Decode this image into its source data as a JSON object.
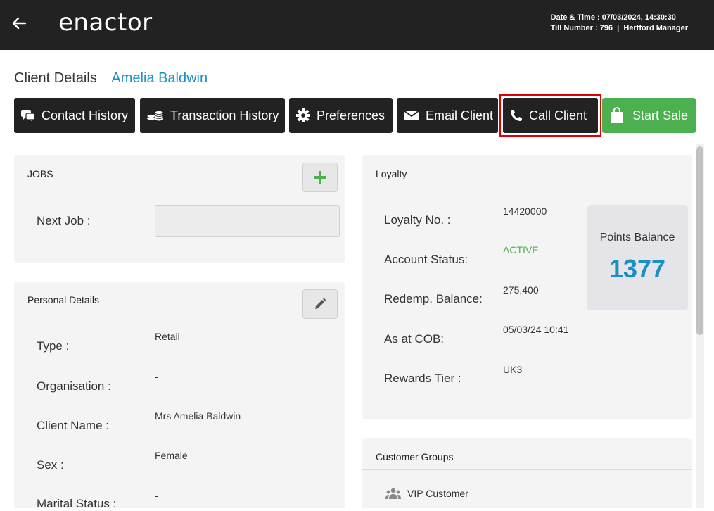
{
  "header": {
    "brand": "enactor",
    "datetime_label": "Date & Time : 07/03/2024, 14:30:30",
    "till_label": "Till Number : 796  |  Hertford Manager"
  },
  "page": {
    "title": "Client Details",
    "client_name": "Amelia Baldwin"
  },
  "actions": [
    {
      "label": "Contact History",
      "icon": "chat-icon"
    },
    {
      "label": "Transaction History",
      "icon": "coins-icon"
    },
    {
      "label": "Preferences",
      "icon": "gear-icon"
    },
    {
      "label": "Email Client",
      "icon": "envelope-icon"
    },
    {
      "label": "Call Client",
      "icon": "phone-icon",
      "highlighted": true
    },
    {
      "label": "Start Sale",
      "icon": "shopping-bag-icon",
      "color": "#4caf50"
    }
  ],
  "jobs": {
    "title": "JOBS",
    "next_job_label": "Next Job :",
    "next_job_value": ""
  },
  "personal": {
    "title": "Personal Details",
    "fields": [
      {
        "label": "Type :",
        "value": "Retail"
      },
      {
        "label": "Organisation :",
        "value": "-"
      },
      {
        "label": "Client Name :",
        "value": "Mrs Amelia Baldwin"
      },
      {
        "label": "Sex :",
        "value": "Female"
      },
      {
        "label": "Marital Status :",
        "value": "-"
      }
    ]
  },
  "loyalty": {
    "title": "Loyalty",
    "fields": [
      {
        "label": "Loyalty No. :",
        "value": "14420000"
      },
      {
        "label": "Account Status:",
        "value": "ACTIVE",
        "color": "#4caf50"
      },
      {
        "label": "Redemp. Balance:",
        "value": "275,400"
      },
      {
        "label": "As at COB:",
        "value": "05/03/24 10:41"
      },
      {
        "label": "Rewards Tier :",
        "value": "UK3"
      }
    ],
    "points_label": "Points Balance",
    "points_value": "1377"
  },
  "customer_groups": {
    "title": "Customer Groups",
    "items": [
      "VIP Customer"
    ]
  },
  "colors": {
    "accent": "#1a8fc1",
    "header_bg": "#222222",
    "success": "#4caf50",
    "highlight": "#e00000"
  }
}
